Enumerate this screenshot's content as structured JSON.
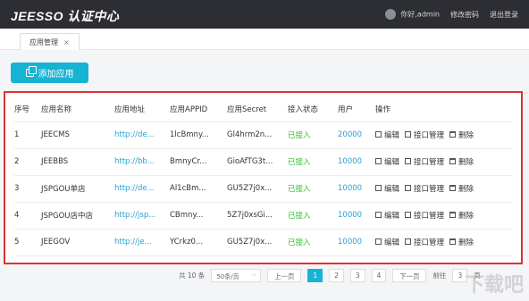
{
  "header": {
    "logo": "JEESSO 认证中心",
    "greeting": "你好,admin",
    "change_password": "修改密码",
    "logout": "退出登录"
  },
  "tabs": [
    {
      "label": "应用管理",
      "close": "×"
    }
  ],
  "add_button": "添加应用",
  "table": {
    "columns": [
      "序号",
      "应用名称",
      "应用地址",
      "应用APPID",
      "应用Secret",
      "接入状态",
      "用户",
      "操作"
    ],
    "rows": [
      {
        "no": "1",
        "name": "JEECMS",
        "url": "http://de...",
        "appid": "1lcBmny...",
        "secret": "Gl4hrm2n...",
        "status": "已接入",
        "users": "20000"
      },
      {
        "no": "2",
        "name": "JEEBBS",
        "url": "http://bb...",
        "appid": "BmnyCr...",
        "secret": "GioAfTG3t...",
        "status": "已接入",
        "users": "10000"
      },
      {
        "no": "3",
        "name": "JSPGOU单店",
        "url": "http://de...",
        "appid": "Al1cBm...",
        "secret": "GU5Z7j0x...",
        "status": "已接入",
        "users": "10000"
      },
      {
        "no": "4",
        "name": "JSPGOU店中店",
        "url": "http://jsp...",
        "appid": "CBmny...",
        "secret": "5Z7j0xsGi...",
        "status": "已接入",
        "users": "10000"
      },
      {
        "no": "5",
        "name": "JEEGOV",
        "url": "http://je...",
        "appid": "YCrkz0...",
        "secret": "GU5Z7j0x...",
        "status": "已接入",
        "users": "10000"
      }
    ],
    "actions": {
      "edit": "编辑",
      "api": "接口管理",
      "delete": "删除"
    }
  },
  "pager": {
    "total": "共 10 条",
    "page_size": "50条/页",
    "prev": "上一页",
    "pages": [
      "1",
      "2",
      "3",
      "4"
    ],
    "next": "下一页",
    "goto": "前往",
    "goto_value": "3",
    "page_unit": "页"
  },
  "watermark": "下载吧"
}
